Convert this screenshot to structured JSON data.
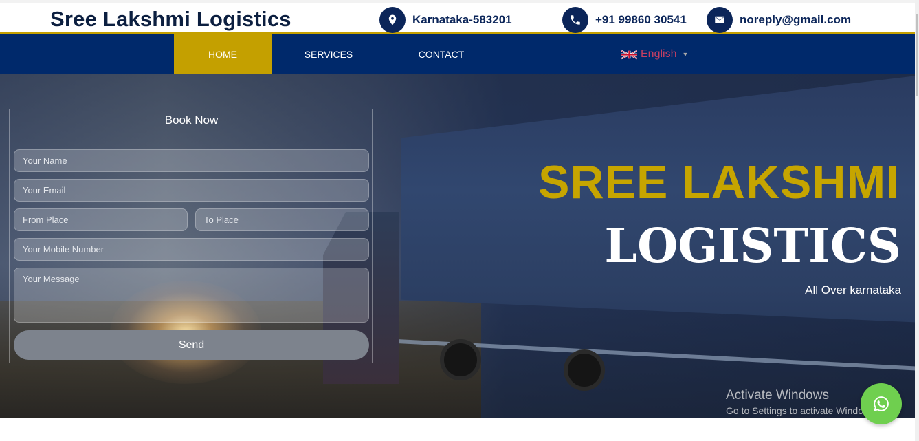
{
  "header": {
    "brand": "Sree Lakshmi Logistics",
    "location": "Karnataka-583201",
    "phone": "+91 99860 30541",
    "email": "noreply@gmail.com"
  },
  "nav": {
    "items": [
      {
        "label": "HOME",
        "active": true
      },
      {
        "label": "SERVICES",
        "active": false
      },
      {
        "label": "CONTACT",
        "active": false
      }
    ],
    "language": "English"
  },
  "form": {
    "title": "Book Now",
    "name_placeholder": "Your Name",
    "email_placeholder": "Your Email",
    "from_placeholder": "From Place",
    "to_placeholder": "To Place",
    "mobile_placeholder": "Your Mobile Number",
    "message_placeholder": "Your Message",
    "send_label": "Send"
  },
  "hero": {
    "line1": "SREE LAKSHMI",
    "line2": "LOGISTICS",
    "tagline": "All Over karnataka"
  },
  "watermark": {
    "title": "Activate Windows",
    "subtitle": "Go to Settings to activate Windows."
  },
  "colors": {
    "navy": "#00296b",
    "gold": "#c4a000",
    "whatsapp": "#6fcf4f"
  }
}
